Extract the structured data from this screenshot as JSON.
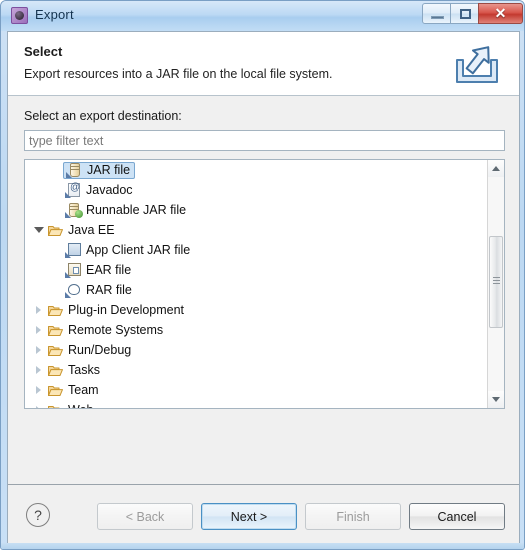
{
  "window": {
    "title": "Export",
    "icon": "export-wizard-icon",
    "controls": {
      "minimize": "minimize-icon",
      "maximize": "restore-icon",
      "close": "✕"
    }
  },
  "banner": {
    "title": "Select",
    "description": "Export resources into a JAR file on the local file system.",
    "icon": "export-arrow-tray-icon"
  },
  "form": {
    "destination_label": "Select an export destination:",
    "filter_placeholder": "type filter text",
    "filter_value": ""
  },
  "tree": {
    "selected": "JAR file",
    "items": [
      {
        "label": "JAR file",
        "indent": 2,
        "icon": "jar-file-icon",
        "twisty": "none",
        "selected": true
      },
      {
        "label": "Javadoc",
        "indent": 2,
        "icon": "javadoc-icon",
        "twisty": "none",
        "selected": false
      },
      {
        "label": "Runnable JAR file",
        "indent": 2,
        "icon": "runnable-jar-icon",
        "twisty": "none",
        "selected": false
      },
      {
        "label": "Java EE",
        "indent": 1,
        "icon": "folder-open-icon",
        "twisty": "expanded",
        "selected": false
      },
      {
        "label": "App Client JAR file",
        "indent": 2,
        "icon": "app-client-jar-icon",
        "twisty": "none",
        "selected": false
      },
      {
        "label": "EAR file",
        "indent": 2,
        "icon": "ear-file-icon",
        "twisty": "none",
        "selected": false
      },
      {
        "label": "RAR file",
        "indent": 2,
        "icon": "rar-file-icon",
        "twisty": "none",
        "selected": false
      },
      {
        "label": "Plug-in Development",
        "indent": 1,
        "icon": "folder-open-icon",
        "twisty": "collapsed",
        "selected": false
      },
      {
        "label": "Remote Systems",
        "indent": 1,
        "icon": "folder-open-icon",
        "twisty": "collapsed",
        "selected": false
      },
      {
        "label": "Run/Debug",
        "indent": 1,
        "icon": "folder-open-icon",
        "twisty": "collapsed",
        "selected": false
      },
      {
        "label": "Tasks",
        "indent": 1,
        "icon": "folder-open-icon",
        "twisty": "collapsed",
        "selected": false
      },
      {
        "label": "Team",
        "indent": 1,
        "icon": "folder-open-icon",
        "twisty": "collapsed",
        "selected": false
      },
      {
        "label": "Web",
        "indent": 1,
        "icon": "folder-open-icon",
        "twisty": "collapsed",
        "selected": false
      }
    ],
    "scrollbar": {
      "up_arrow": "scroll-up-icon",
      "down_arrow": "scroll-down-icon"
    }
  },
  "footer": {
    "help": "?",
    "back": "< Back",
    "next": "Next >",
    "finish": "Finish",
    "cancel": "Cancel"
  },
  "colors": {
    "titlebar": "#bcd9f4",
    "dialog_bg": "#f0f0f0",
    "banner_bg": "#ffffff",
    "selection": "#cde2f5",
    "default_button_border": "#4a90c4",
    "close_button": "#c3392f",
    "folder": "#e8b54d"
  }
}
